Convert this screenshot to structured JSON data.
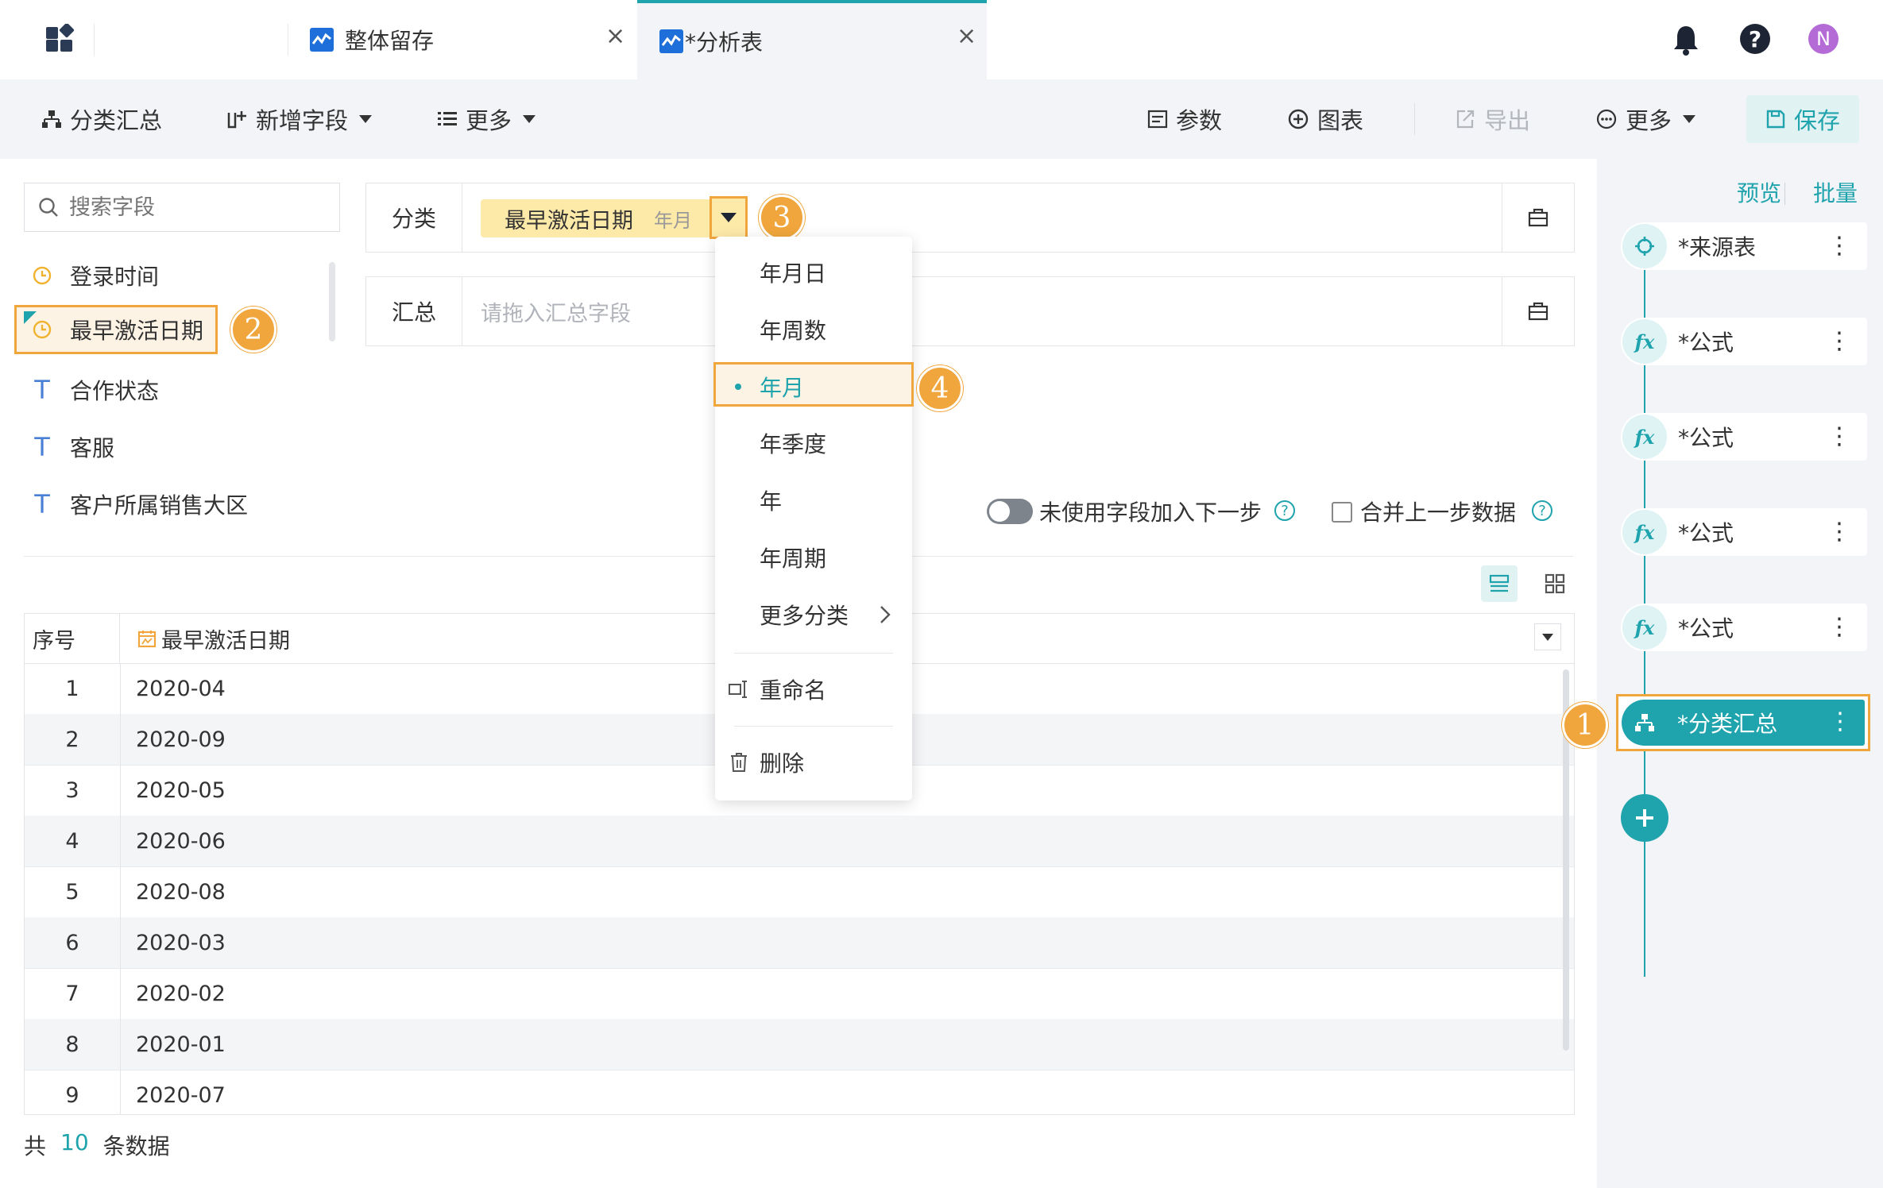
{
  "tabs": [
    {
      "label": "整体留存",
      "close": "×"
    },
    {
      "label": "*分析表",
      "close": "×"
    }
  ],
  "header_icons": {
    "avatar_letter": "N"
  },
  "toolbar": {
    "group_summary": "分类汇总",
    "add_field": "新增字段",
    "more_left": "更多",
    "params": "参数",
    "chart": "图表",
    "export": "导出",
    "more_right": "更多",
    "save": "保存"
  },
  "search": {
    "placeholder": "搜索字段"
  },
  "fields": [
    {
      "label": "登录时间",
      "type": "date"
    },
    {
      "label": "最早激活日期",
      "type": "date-new",
      "badge": "2"
    },
    {
      "label": "合作状态",
      "type": "text"
    },
    {
      "label": "客服",
      "type": "text"
    },
    {
      "label": "客户所属销售大区",
      "type": "text"
    }
  ],
  "classify": {
    "label": "分类",
    "chip_text": "最早激活日期",
    "chip_sub": "年月",
    "badge": "3"
  },
  "summary": {
    "label": "汇总",
    "placeholder": "请拖入汇总字段"
  },
  "options": {
    "unused_fields": "未使用字段加入下一步",
    "merge_prev": "合并上一步数据"
  },
  "menu": {
    "items": [
      "年月日",
      "年周数",
      "年月",
      "年季度",
      "年",
      "年周期",
      "更多分类"
    ],
    "selected_badge": "4",
    "rename": "重命名",
    "delete": "删除"
  },
  "table": {
    "col_index": "序号",
    "col_field": "最早激活日期",
    "rows": [
      {
        "n": "1",
        "v": "2020-04"
      },
      {
        "n": "2",
        "v": "2020-09"
      },
      {
        "n": "3",
        "v": "2020-05"
      },
      {
        "n": "4",
        "v": "2020-06"
      },
      {
        "n": "5",
        "v": "2020-08"
      },
      {
        "n": "6",
        "v": "2020-03"
      },
      {
        "n": "7",
        "v": "2020-02"
      },
      {
        "n": "8",
        "v": "2020-01"
      },
      {
        "n": "9",
        "v": "2020-07"
      }
    ]
  },
  "footer": {
    "prefix": "共",
    "count": "10",
    "suffix": "条数据"
  },
  "right_panel": {
    "preview": "预览",
    "batch": "批量",
    "steps": [
      "*来源表",
      "*公式",
      "*公式",
      "*公式",
      "*公式",
      "*分类汇总"
    ],
    "active_badge": "1"
  },
  "colors": {
    "accent": "#1fa3ad",
    "highlight": "#f0a63c",
    "chip": "#fde9a8"
  }
}
